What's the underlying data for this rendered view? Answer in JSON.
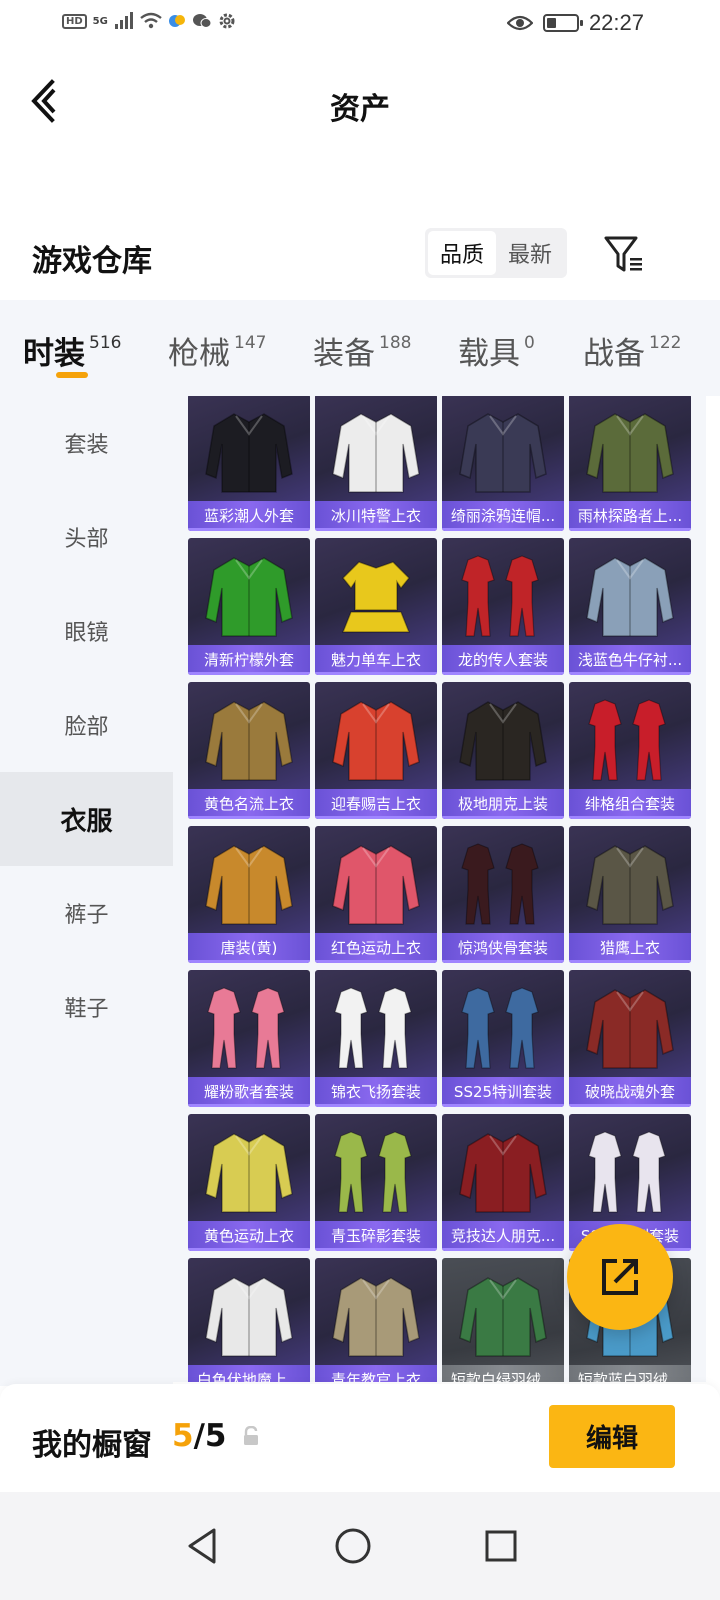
{
  "status_bar": {
    "time": "22:27",
    "network": "5G",
    "hd": "HD"
  },
  "header": {
    "title": "资产"
  },
  "warehouse": {
    "title": "游戏仓库",
    "sort_quality": "品质",
    "sort_latest": "最新"
  },
  "categories": [
    {
      "label": "时装",
      "count": "516"
    },
    {
      "label": "枪械",
      "count": "147"
    },
    {
      "label": "装备",
      "count": "188"
    },
    {
      "label": "载具",
      "count": "0"
    },
    {
      "label": "战备",
      "count": "122"
    }
  ],
  "side_nav": [
    "套装",
    "头部",
    "眼镜",
    "脸部",
    "衣服",
    "裤子",
    "鞋子"
  ],
  "items": [
    {
      "name": "蓝彩潮人外套",
      "color": "#1c1c22",
      "kind": "jacket"
    },
    {
      "name": "冰川特警上衣",
      "color": "#ececec",
      "kind": "jacket"
    },
    {
      "name": "绮丽涂鸦连帽...",
      "color": "#3a3a55",
      "kind": "jacket"
    },
    {
      "name": "雨林探路者上...",
      "color": "#5b6b3a",
      "kind": "jacket"
    },
    {
      "name": "清新柠檬外套",
      "color": "#2f9b2a",
      "kind": "jacket"
    },
    {
      "name": "魅力单车上衣",
      "color": "#e8c81c",
      "kind": "shirt"
    },
    {
      "name": "龙的传人套装",
      "color": "#c02428",
      "kind": "set"
    },
    {
      "name": "浅蓝色牛仔衬...",
      "color": "#8aa0b8",
      "kind": "jacket"
    },
    {
      "name": "黄色名流上衣",
      "color": "#9a7a3c",
      "kind": "jacket"
    },
    {
      "name": "迎春赐吉上衣",
      "color": "#d8412e",
      "kind": "jacket"
    },
    {
      "name": "极地朋克上装",
      "color": "#2a2622",
      "kind": "jacket"
    },
    {
      "name": "绯格组合套装",
      "color": "#c81e2a",
      "kind": "set"
    },
    {
      "name": "唐装(黄)",
      "color": "#c8892c",
      "kind": "jacket"
    },
    {
      "name": "红色运动上衣",
      "color": "#e0566a",
      "kind": "jacket"
    },
    {
      "name": "惊鸿侠骨套装",
      "color": "#3a1a1e",
      "kind": "set"
    },
    {
      "name": "猎鹰上衣",
      "color": "#5a5646",
      "kind": "jacket"
    },
    {
      "name": "耀粉歌者套装",
      "color": "#e87a96",
      "kind": "set"
    },
    {
      "name": "锦衣飞扬套装",
      "color": "#f2f2f2",
      "kind": "set"
    },
    {
      "name": "SS25特训套装",
      "color": "#3e6aa0",
      "kind": "set"
    },
    {
      "name": "破晓战魂外套",
      "color": "#8a2a26",
      "kind": "jacket"
    },
    {
      "name": "黄色运动上衣",
      "color": "#d8cc52",
      "kind": "jacket"
    },
    {
      "name": "青玉碎影套装",
      "color": "#9ab84a",
      "kind": "set"
    },
    {
      "name": "竞技达人朋克...",
      "color": "#8a1e22",
      "kind": "jacket"
    },
    {
      "name": "SS25特训套装",
      "color": "#e8e4ee",
      "kind": "set"
    },
    {
      "name": "白色伏地魔上...",
      "color": "#e8e8e8",
      "kind": "jacket"
    },
    {
      "name": "青年教官上衣",
      "color": "#a89a78",
      "kind": "jacket"
    },
    {
      "name": "短款白绿羽绒...",
      "color": "#3a7a44",
      "kind": "jacket",
      "grey": true
    },
    {
      "name": "短款蓝白羽绒...",
      "color": "#4a9ac8",
      "kind": "jacket",
      "grey": true
    }
  ],
  "showcase": {
    "label": "我的橱窗",
    "current": "5",
    "total": "/5",
    "edit_label": "编辑"
  },
  "colors": {
    "accent": "#fbb613",
    "card_label": "#7a5ee6"
  },
  "icons": [
    "back-arrow-icon",
    "filter-icon",
    "share-icon",
    "lock-icon",
    "nav-back-icon",
    "nav-home-icon",
    "nav-recent-icon"
  ]
}
